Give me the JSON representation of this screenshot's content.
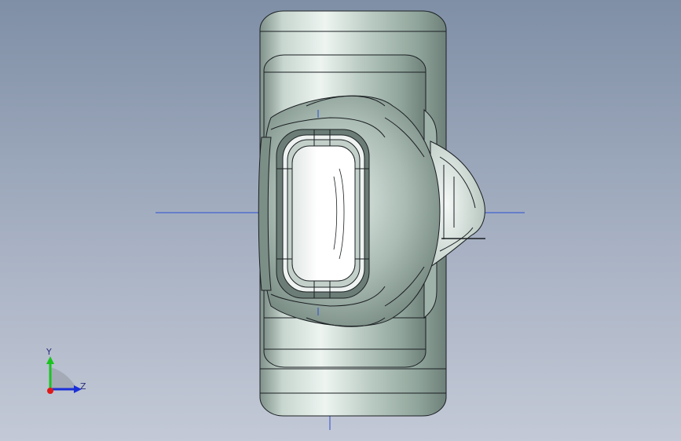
{
  "view": {
    "background_top": "#7f8fa6",
    "background_bottom": "#c3c9d6",
    "model_color": "#b8c8c0",
    "edge_color": "#1b1f22",
    "axis_line_color": "#2b4fd0"
  },
  "triad": {
    "y_label": "Y",
    "z_label": "Z",
    "y_color": "#19c41f",
    "z_color": "#1a2fd8",
    "origin_color": "#e01818"
  }
}
